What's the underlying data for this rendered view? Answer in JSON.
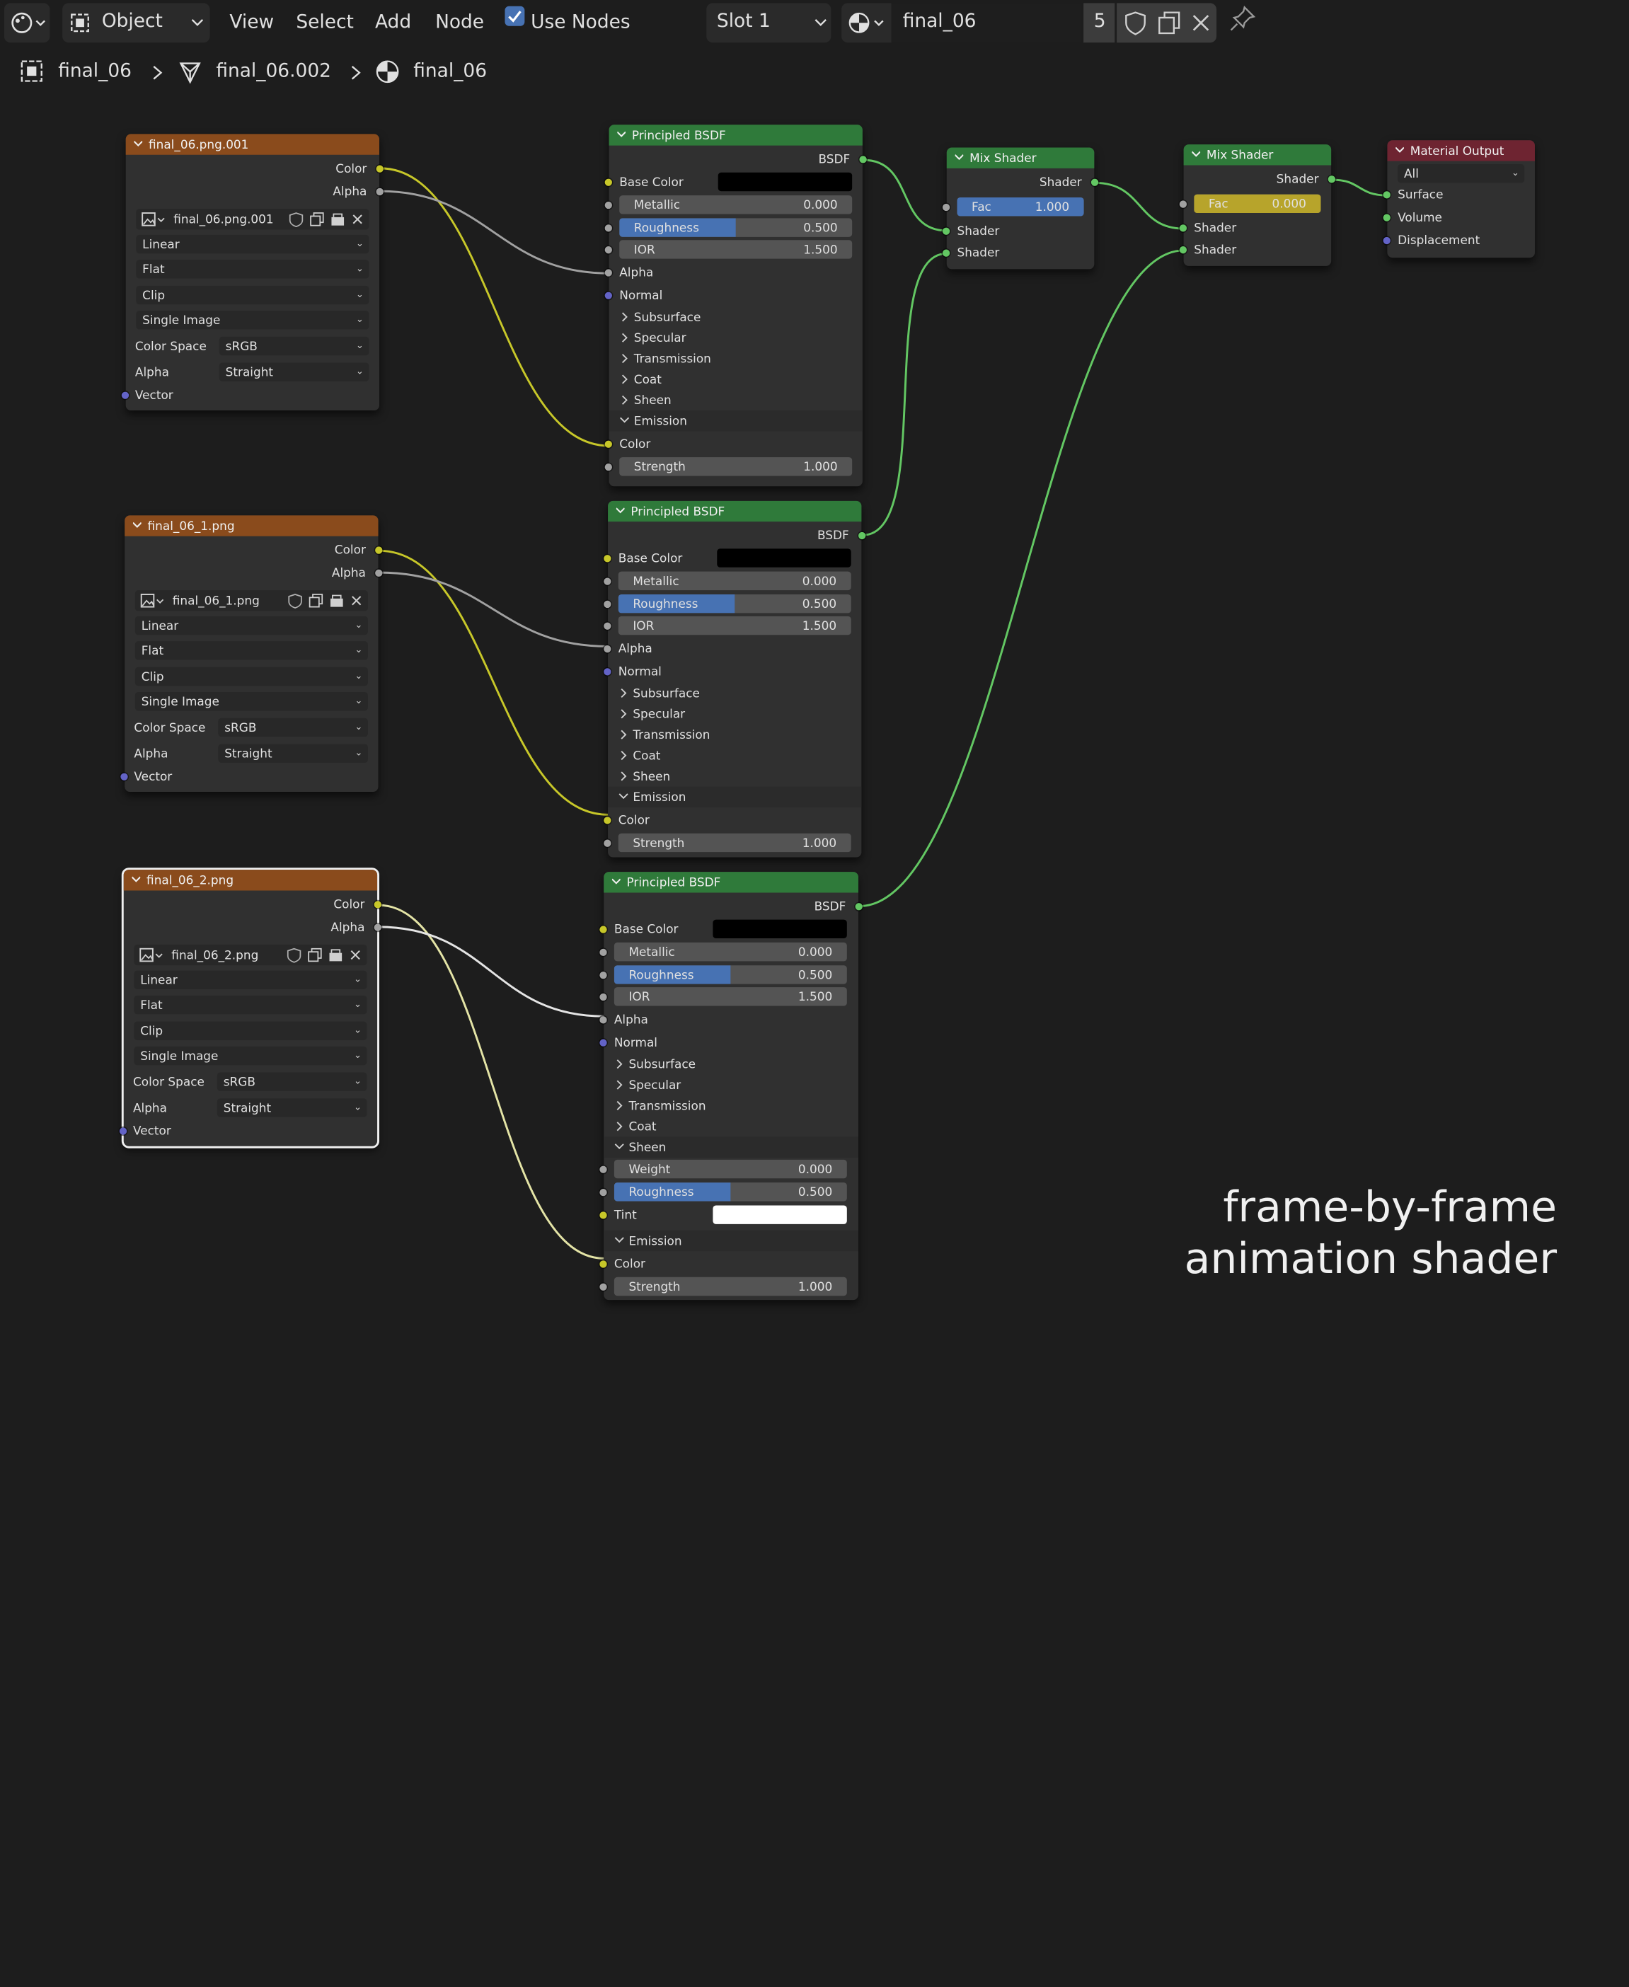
{
  "header": {
    "mode_value": "Object",
    "menus": [
      "View",
      "Select",
      "Add",
      "Node"
    ],
    "use_nodes_label": "Use Nodes",
    "slot_value": "Slot 1",
    "material_name": "final_06",
    "user_count": "5"
  },
  "breadcrumb": {
    "object": "final_06",
    "mesh": "final_06.002",
    "material": "final_06"
  },
  "image_nodes": [
    {
      "title": "final_06.png.001",
      "color_label": "Color",
      "alpha_label": "Alpha",
      "image": "final_06.png.001",
      "interpolation": "Linear",
      "projection": "Flat",
      "extension": "Clip",
      "source": "Single Image",
      "color_space_label": "Color Space",
      "color_space": "sRGB",
      "alpha_mode_label": "Alpha",
      "alpha_mode": "Straight",
      "vector_label": "Vector"
    },
    {
      "title": "final_06_1.png",
      "color_label": "Color",
      "alpha_label": "Alpha",
      "image": "final_06_1.png",
      "interpolation": "Linear",
      "projection": "Flat",
      "extension": "Clip",
      "source": "Single Image",
      "color_space_label": "Color Space",
      "color_space": "sRGB",
      "alpha_mode_label": "Alpha",
      "alpha_mode": "Straight",
      "vector_label": "Vector"
    },
    {
      "title": "final_06_2.png",
      "color_label": "Color",
      "alpha_label": "Alpha",
      "image": "final_06_2.png",
      "interpolation": "Linear",
      "projection": "Flat",
      "extension": "Clip",
      "source": "Single Image",
      "color_space_label": "Color Space",
      "color_space": "sRGB",
      "alpha_mode_label": "Alpha",
      "alpha_mode": "Straight",
      "vector_label": "Vector"
    }
  ],
  "bsdf_nodes": [
    {
      "title": "Principled BSDF",
      "output": "BSDF",
      "base_color_label": "Base Color",
      "metallic_label": "Metallic",
      "metallic": "0.000",
      "roughness_label": "Roughness",
      "roughness": "0.500",
      "roughness_fraction": 0.5,
      "ior_label": "IOR",
      "ior": "1.500",
      "alpha_label": "Alpha",
      "normal_label": "Normal",
      "panels": [
        "Subsurface",
        "Specular",
        "Transmission",
        "Coat",
        "Sheen"
      ],
      "emission_label": "Emission",
      "emission_color_label": "Color",
      "strength_label": "Strength",
      "strength": "1.000"
    },
    {
      "title": "Principled BSDF",
      "output": "BSDF",
      "base_color_label": "Base Color",
      "metallic_label": "Metallic",
      "metallic": "0.000",
      "roughness_label": "Roughness",
      "roughness": "0.500",
      "roughness_fraction": 0.5,
      "ior_label": "IOR",
      "ior": "1.500",
      "alpha_label": "Alpha",
      "normal_label": "Normal",
      "panels": [
        "Subsurface",
        "Specular",
        "Transmission",
        "Coat",
        "Sheen"
      ],
      "emission_label": "Emission",
      "emission_color_label": "Color",
      "strength_label": "Strength",
      "strength": "1.000"
    },
    {
      "title": "Principled BSDF",
      "output": "BSDF",
      "base_color_label": "Base Color",
      "metallic_label": "Metallic",
      "metallic": "0.000",
      "roughness_label": "Roughness",
      "roughness": "0.500",
      "roughness_fraction": 0.5,
      "ior_label": "IOR",
      "ior": "1.500",
      "alpha_label": "Alpha",
      "normal_label": "Normal",
      "panels": [
        "Subsurface",
        "Specular",
        "Transmission",
        "Coat"
      ],
      "sheen_label": "Sheen",
      "sheen_weight_label": "Weight",
      "sheen_weight": "0.000",
      "sheen_roughness_label": "Roughness",
      "sheen_roughness": "0.500",
      "sheen_roughness_fraction": 0.5,
      "sheen_tint_label": "Tint",
      "emission_label": "Emission",
      "emission_color_label": "Color",
      "strength_label": "Strength",
      "strength": "1.000"
    }
  ],
  "mix_nodes": [
    {
      "title": "Mix Shader",
      "output": "Shader",
      "fac_label": "Fac",
      "fac": "1.000",
      "fac_fraction": 1.0,
      "shader1": "Shader",
      "shader2": "Shader"
    },
    {
      "title": "Mix Shader",
      "output": "Shader",
      "fac_label": "Fac",
      "fac": "0.000",
      "fac_fraction": 0.0,
      "shader1": "Shader",
      "shader2": "Shader"
    }
  ],
  "output_node": {
    "title": "Material Output",
    "target": "All",
    "surface": "Surface",
    "volume": "Volume",
    "displacement": "Displacement"
  },
  "caption": {
    "line1": "frame-by-frame",
    "line2": "animation shader"
  },
  "colors": {
    "socket_color": "#c7c729",
    "socket_float": "#a1a1a1",
    "socket_shader": "#63c763",
    "socket_vector": "#6363c7",
    "texture_header": "#8a4b1c",
    "shader_header": "#2f7a3a",
    "output_header": "#6e2431",
    "slider_fill": "#4772b3",
    "mix1_fac_fill": "#4772b3",
    "mix2_fac_fill": "#b7a42b",
    "base_color": "#000000",
    "sheen_tint": "#ffffff"
  }
}
